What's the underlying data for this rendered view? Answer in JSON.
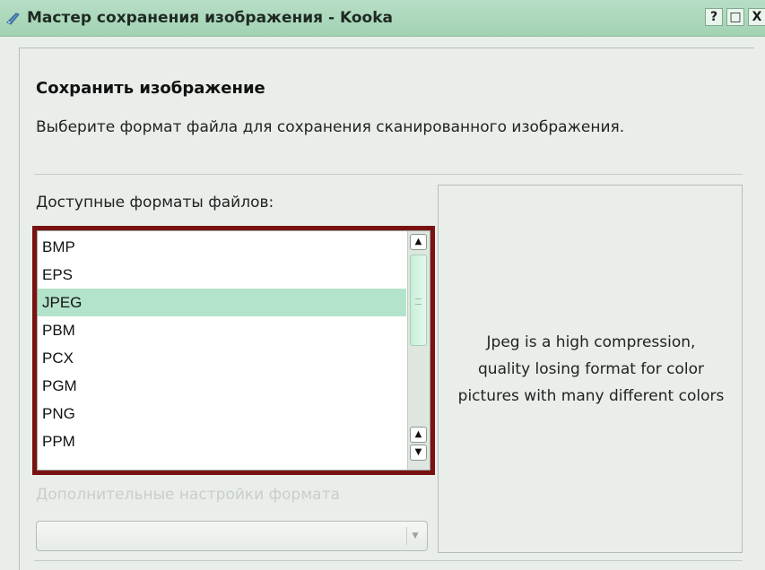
{
  "window": {
    "title": "Мастер сохранения изображения - Kooka",
    "buttons": {
      "help": "?",
      "maximize": "□",
      "close": "X"
    },
    "titlebar_color": "#a9d6b9"
  },
  "page": {
    "heading": "Сохранить изображение",
    "description": "Выберите формат файла для сохранения сканированного изображения."
  },
  "formats": {
    "label": "Доступные форматы файлов:",
    "items": [
      "BMP",
      "EPS",
      "JPEG",
      "PBM",
      "PCX",
      "PGM",
      "PNG",
      "PPM"
    ],
    "selected": "JPEG",
    "highlight_color": "#b4e3cc",
    "outline_color": "#7a1212"
  },
  "preview": {
    "text_lines": [
      "Jpeg is a high compression,",
      "quality losing format for color",
      "pictures with many different colors"
    ]
  },
  "options": {
    "label": "Дополнительные настройки формата",
    "combo_value": ""
  },
  "icons": {
    "window": "kooka-scanner-icon",
    "scroll_up": "arrow-up-icon",
    "scroll_down": "arrow-down-icon",
    "combo": "chevron-down-icon"
  }
}
